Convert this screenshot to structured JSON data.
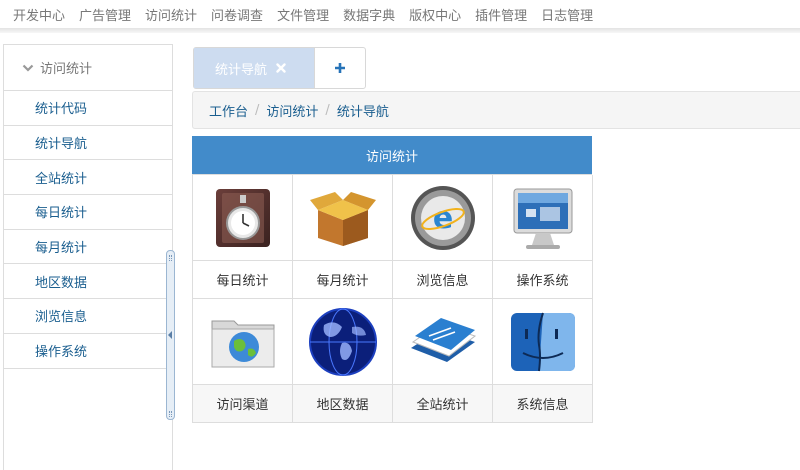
{
  "topnav": [
    "开发中心",
    "广告管理",
    "访问统计",
    "问卷调查",
    "文件管理",
    "数据字典",
    "版权中心",
    "插件管理",
    "日志管理"
  ],
  "sidebar": {
    "header": "访问统计",
    "items": [
      "统计代码",
      "统计导航",
      "全站统计",
      "每日统计",
      "每月统计",
      "地区数据",
      "浏览信息",
      "操作系统"
    ]
  },
  "tabs": {
    "active_label": "统计导航",
    "add_label": "+"
  },
  "breadcrumb": [
    "工作台",
    "访问统计",
    "统计导航"
  ],
  "panel": {
    "title": "访问统计",
    "cells": [
      {
        "label": "每日统计",
        "icon": "stopwatch-icon"
      },
      {
        "label": "每月统计",
        "icon": "package-box-icon"
      },
      {
        "label": "浏览信息",
        "icon": "browser-icon"
      },
      {
        "label": "操作系统",
        "icon": "monitor-icon"
      },
      {
        "label": "访问渠道",
        "icon": "network-folder-icon"
      },
      {
        "label": "地区数据",
        "icon": "globe-icon"
      },
      {
        "label": "全站统计",
        "icon": "documents-icon"
      },
      {
        "label": "系统信息",
        "icon": "finder-icon"
      }
    ]
  },
  "colors": {
    "panel_header": "#428bca",
    "link": "#1a5e8f",
    "tab_active": "#cddcf0",
    "plus": "#2673b8"
  }
}
